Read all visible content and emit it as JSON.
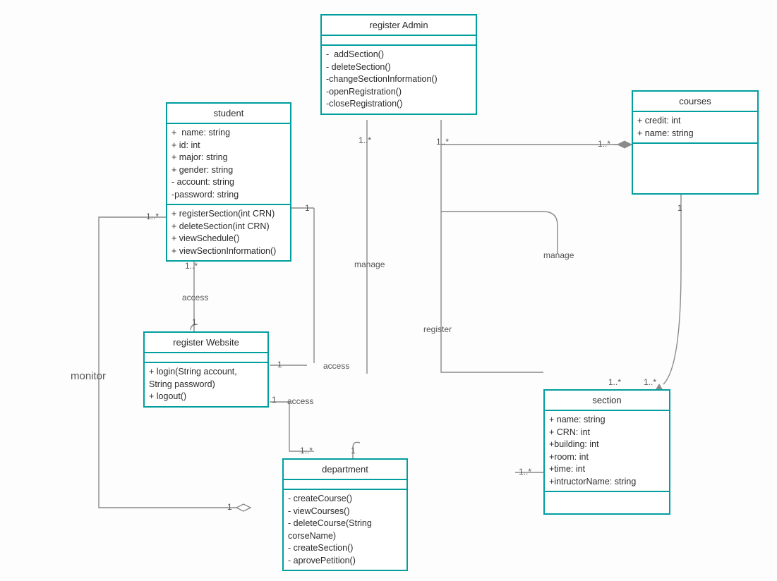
{
  "classes": {
    "registerAdmin": {
      "title": "register Admin",
      "attrs": [],
      "ops": [
        "-  addSection()",
        "- deleteSection()",
        "-changeSectionInformation()",
        "-openRegistration()",
        "-closeRegistration()"
      ]
    },
    "student": {
      "title": "student",
      "attrs": [
        "+  name: string",
        "+ id: int",
        "+ major: string",
        "+ gender: string",
        "- account: string",
        "-password: string"
      ],
      "ops": [
        "+ registerSection(int CRN)",
        "+ deleteSection(int CRN)",
        "+ viewSchedule()",
        "+ viewSectionInformation()"
      ]
    },
    "courses": {
      "title": "courses",
      "attrs": [
        "+ credit: int",
        "+ name: string"
      ],
      "ops": []
    },
    "registerWebsite": {
      "title": "register Website",
      "attrs": [],
      "ops": [
        "+ login(String account,",
        "String password)",
        "+ logout()"
      ]
    },
    "section": {
      "title": "section",
      "attrs": [
        "+ name: string",
        "+ CRN: int",
        "+building: int",
        "+room: int",
        "+time: int",
        "+intructorName: string"
      ],
      "ops": []
    },
    "department": {
      "title": "department",
      "attrs": [],
      "ops": [
        "- createCourse()",
        "- viewCourses()",
        "- deleteCourse(String",
        "corseName)",
        "- createSection()",
        "- aprovePetition()"
      ]
    }
  },
  "labels": {
    "monitor": "monitor",
    "access1": "access",
    "access2": "access",
    "access3": "access",
    "manage1": "manage",
    "manage2": "manage",
    "register": "register",
    "m_1star_a": "1..*",
    "m_1star_b": "1..*",
    "m_1star_c": "1..*",
    "m_1star_d": "1..*",
    "m_1star_e": "1..*",
    "m_1star_f": "1..*",
    "m_1star_g": "1..*",
    "m_1star_h": "1..*",
    "m_1star_i": "1..*",
    "m_1_a": "1",
    "m_1_b": "1",
    "m_1_c": "1",
    "m_1_d": "1",
    "m_1_e": "1",
    "m_1_f": "1",
    "m_1_g": "1"
  }
}
